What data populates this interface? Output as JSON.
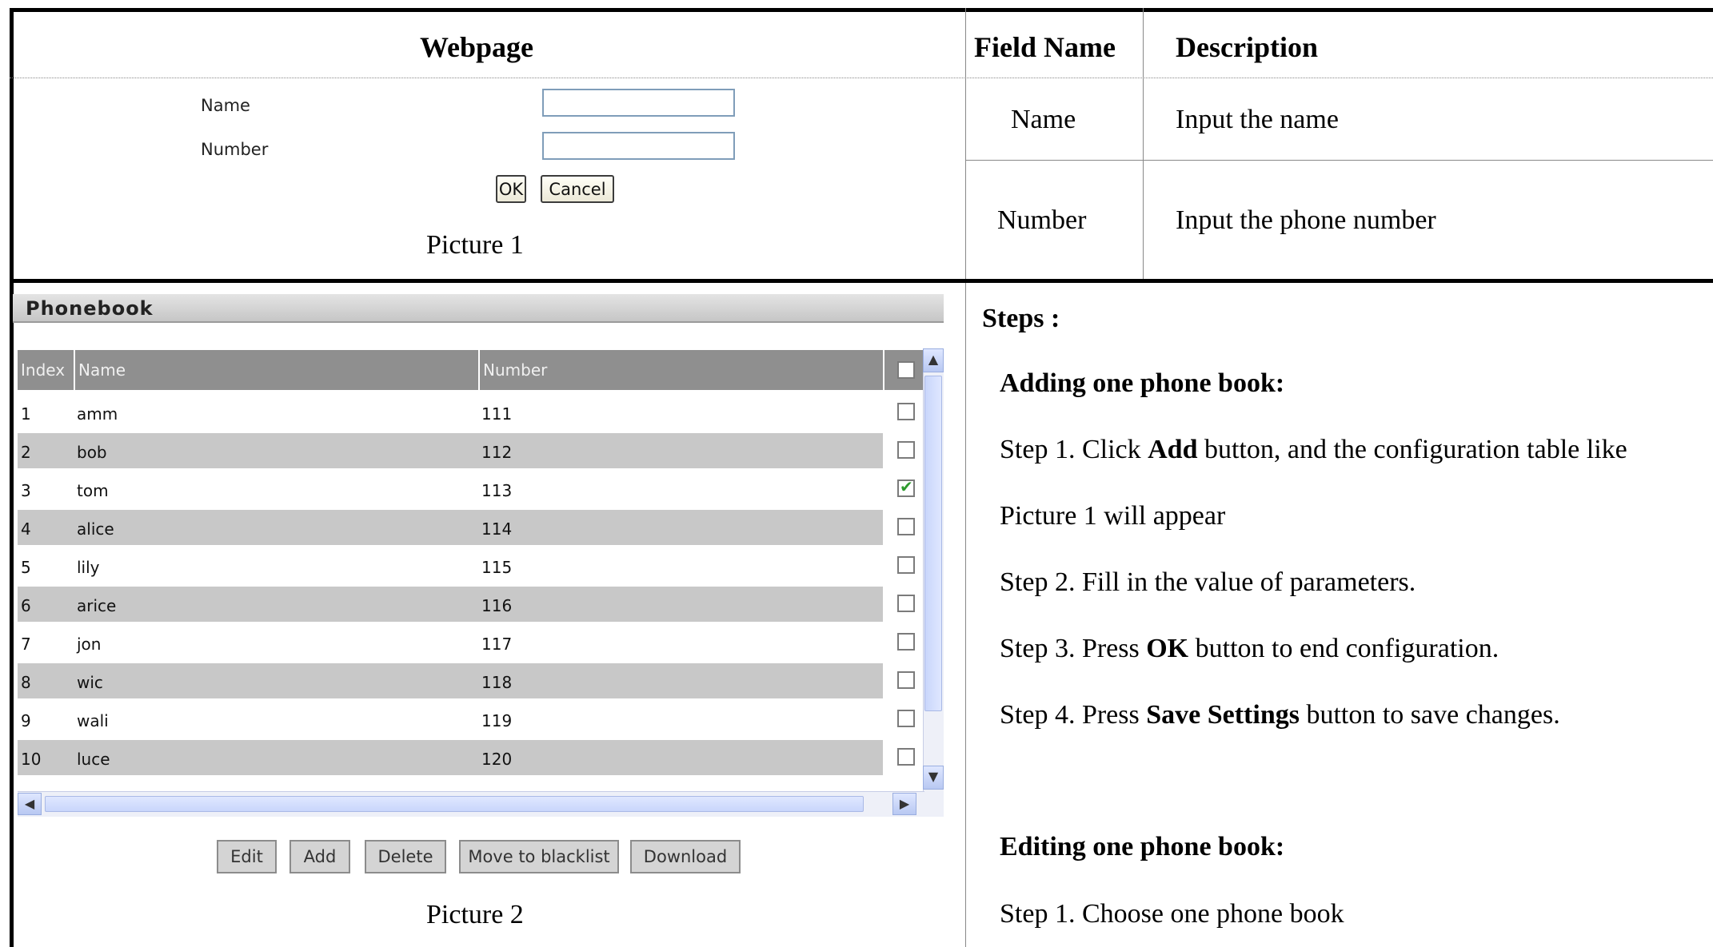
{
  "top_table": {
    "col_webpage": "Webpage",
    "col_field_name": "Field Name",
    "col_description": "Description",
    "rows": [
      {
        "field": "Name",
        "description": "Input the name"
      },
      {
        "field": "Number",
        "description": "Input the phone number"
      }
    ]
  },
  "picture1": {
    "name_label": "Name",
    "number_label": "Number",
    "name_value": "",
    "number_value": "",
    "ok_label": "OK",
    "cancel_label": "Cancel",
    "caption": "Picture 1"
  },
  "picture2": {
    "panel_title": "Phonebook",
    "columns": [
      "Index",
      "Name",
      "Number"
    ],
    "rows": [
      {
        "index": "1",
        "name": "amm",
        "number": "111",
        "checked": false
      },
      {
        "index": "2",
        "name": "bob",
        "number": "112",
        "checked": false
      },
      {
        "index": "3",
        "name": "tom",
        "number": "113",
        "checked": true
      },
      {
        "index": "4",
        "name": "alice",
        "number": "114",
        "checked": false
      },
      {
        "index": "5",
        "name": "lily",
        "number": "115",
        "checked": false
      },
      {
        "index": "6",
        "name": "arice",
        "number": "116",
        "checked": false
      },
      {
        "index": "7",
        "name": "jon",
        "number": "117",
        "checked": false
      },
      {
        "index": "8",
        "name": "wic",
        "number": "118",
        "checked": false
      },
      {
        "index": "9",
        "name": "wali",
        "number": "119",
        "checked": false
      },
      {
        "index": "10",
        "name": "luce",
        "number": "120",
        "checked": false
      }
    ],
    "buttons": {
      "edit": "Edit",
      "add": "Add",
      "delete": "Delete",
      "blacklist": "Move to blacklist",
      "download": "Download"
    },
    "caption": "Picture 2"
  },
  "steps": {
    "heading": "Steps :",
    "adding_heading": "Adding one phone book:",
    "step1_pre": "Step 1. Click ",
    "step1_bold": "Add",
    "step1_post": " button, and the configuration table like",
    "step1_line2": "Picture 1 will appear",
    "step2": "Step 2. Fill in the value of parameters.",
    "step3_pre": "Step 3. Press ",
    "step3_bold": "OK",
    "step3_post": " button to end configuration.",
    "step4_pre": "Step 4. Press ",
    "step4_bold": "Save Settings",
    "step4_post": " button to save changes.",
    "editing_heading": "Editing one phone book:",
    "edit_step1": "Step 1. Choose one phone book"
  },
  "colors": {
    "header_grey": "#8f8f8f",
    "alt_row": "#c8c8c8",
    "check_green": "#2e9a2e"
  }
}
